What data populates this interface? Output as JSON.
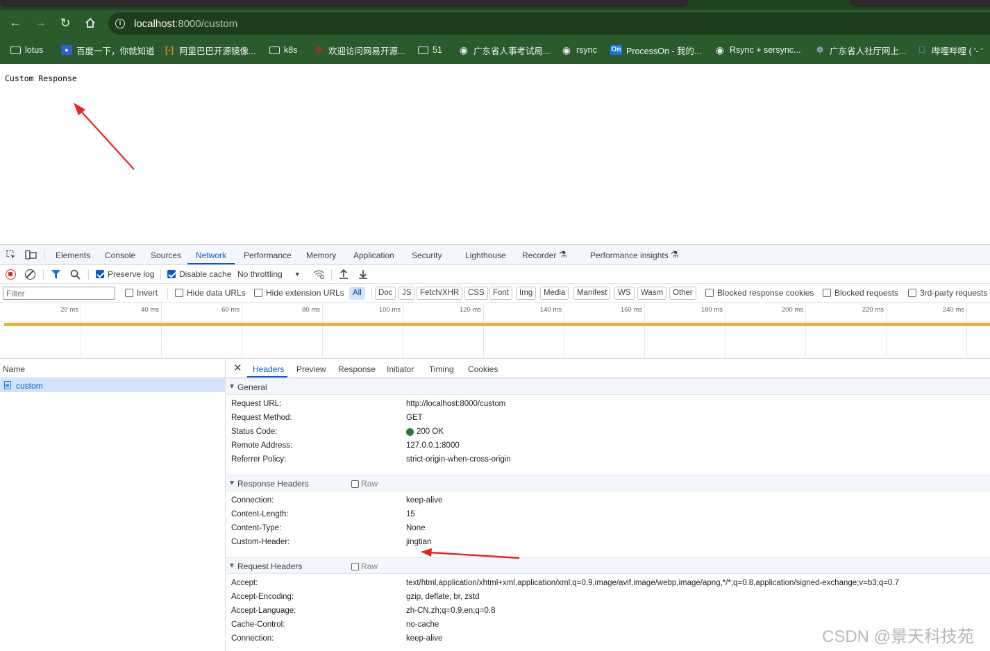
{
  "browser": {
    "url_host": "localhost",
    "url_path": ":8000/custom",
    "bookmarks": [
      {
        "label": "lotus",
        "icon": "folder-icon"
      },
      {
        "label": "百度一下，你就知道",
        "icon": "baidu-icon"
      },
      {
        "label": "阿里巴巴开源镜像...",
        "icon": "alibaba-icon"
      },
      {
        "label": "k8s",
        "icon": "folder-icon"
      },
      {
        "label": "欢迎访问网易开源...",
        "icon": "netease-icon"
      },
      {
        "label": "51",
        "icon": "folder-icon"
      },
      {
        "label": "广东省人事考试局...",
        "icon": "globe-icon"
      },
      {
        "label": "rsync",
        "icon": "globe-icon"
      },
      {
        "label": "ProcessOn - 我的...",
        "icon": "processon-icon",
        "badge": "On"
      },
      {
        "label": "Rsync + sersync...",
        "icon": "globe-icon"
      },
      {
        "label": "广东省人社厅网上...",
        "icon": "gd-icon"
      },
      {
        "label": "哔哩哔哩 ( '- '",
        "icon": "bilibili-icon"
      }
    ]
  },
  "page": {
    "body_text": "Custom Response"
  },
  "devtools": {
    "tabs": [
      "Elements",
      "Console",
      "Sources",
      "Network",
      "Performance",
      "Memory",
      "Application",
      "Security",
      "Lighthouse",
      "Recorder",
      "Performance insights"
    ],
    "active_tab": "Network",
    "toolbar": {
      "preserve_log": "Preserve log",
      "disable_cache": "Disable cache",
      "throttling": "No throttling"
    },
    "filterbar": {
      "filter_placeholder": "Filter",
      "invert": "Invert",
      "hide_data_urls": "Hide data URLs",
      "hide_extension_urls": "Hide extension URLs",
      "types": [
        "All",
        "Doc",
        "JS",
        "Fetch/XHR",
        "CSS",
        "Font",
        "Img",
        "Media",
        "Manifest",
        "WS",
        "Wasm",
        "Other"
      ],
      "active_type": "All",
      "blocked_response_cookies": "Blocked response cookies",
      "blocked_requests": "Blocked requests",
      "third_party_requests": "3rd-party requests"
    },
    "overview_ticks": [
      "20 ms",
      "40 ms",
      "60 ms",
      "80 ms",
      "100 ms",
      "120 ms",
      "140 ms",
      "160 ms",
      "180 ms",
      "200 ms",
      "220 ms",
      "240 ms"
    ],
    "request_list": {
      "header": "Name",
      "items": [
        "custom"
      ]
    },
    "details": {
      "tabs": [
        "Headers",
        "Preview",
        "Response",
        "Initiator",
        "Timing",
        "Cookies"
      ],
      "active_tab": "Headers",
      "general": {
        "title": "General",
        "rows": [
          {
            "k": "Request URL:",
            "v": "http://localhost:8000/custom"
          },
          {
            "k": "Request Method:",
            "v": "GET"
          },
          {
            "k": "Status Code:",
            "v": "200 OK"
          },
          {
            "k": "Remote Address:",
            "v": "127.0.0.1:8000"
          },
          {
            "k": "Referrer Policy:",
            "v": "strict-origin-when-cross-origin"
          }
        ]
      },
      "response_headers": {
        "title": "Response Headers",
        "raw": "Raw",
        "rows": [
          {
            "k": "Connection:",
            "v": "keep-alive"
          },
          {
            "k": "Content-Length:",
            "v": "15"
          },
          {
            "k": "Content-Type:",
            "v": "None"
          },
          {
            "k": "Custom-Header:",
            "v": "jingtian"
          }
        ]
      },
      "request_headers": {
        "title": "Request Headers",
        "raw": "Raw",
        "rows": [
          {
            "k": "Accept:",
            "v": "text/html,application/xhtml+xml,application/xml;q=0.9,image/avif,image/webp,image/apng,*/*;q=0.8,application/signed-exchange;v=b3;q=0.7"
          },
          {
            "k": "Accept-Encoding:",
            "v": "gzip, deflate, br, zstd"
          },
          {
            "k": "Accept-Language:",
            "v": "zh-CN,zh;q=0.9,en;q=0.8"
          },
          {
            "k": "Cache-Control:",
            "v": "no-cache"
          },
          {
            "k": "Connection:",
            "v": "keep-alive"
          }
        ]
      }
    }
  },
  "watermark": "CSDN @景天科技苑",
  "colors": {
    "chrome_green": "#2b5b2d",
    "accent_blue": "#0b57d0",
    "status_green": "#188038",
    "annotation_red": "#e8231f",
    "overview_bar": "#e0b33a"
  }
}
